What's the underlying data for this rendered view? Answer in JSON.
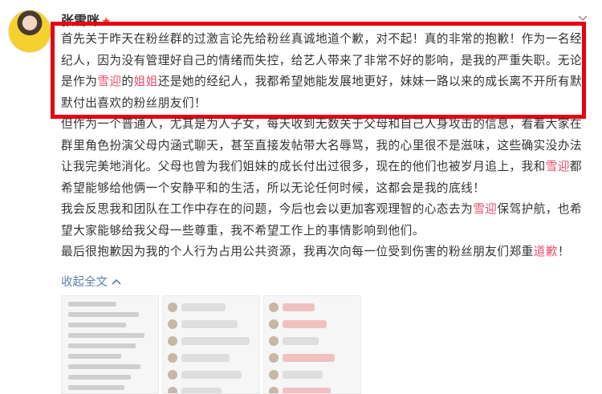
{
  "user": {
    "name": "张雪咪",
    "badge": "★"
  },
  "post": {
    "paragraph1": {
      "parts": [
        "首先关于昨天在粉丝群的过激言论先给粉丝真诚地道个歉，对不起！真的非常的抱歉！作为一名经纪人，因为没有管理好自己的情绪而失控，给艺人带来了非常不好的影响，是我的严重失职。无论是作为",
        "雪迎",
        "的",
        "姐姐",
        "还是她的经纪人，我都希望她能发展地更好，妹妹一路以来的成长离不开所有默默付出喜欢的粉丝朋友们！"
      ]
    },
    "paragraph2": {
      "parts": [
        "但作为一个普通人，尤其是为人子女，每天收到无数关于父母和自己人身攻击的信息，看着大家在群里角色扮演父母内涵式聊天，甚至直接发帖带大名辱骂，我的心里很不是滋味，这些确实没办法让我完美地消化。父母也曾为我们姐妹的成长付出过很多，现在的他们也被岁月追上，我和",
        "雪迎",
        "都希望能够给他俩一个安静平和的生活，所以无论任何时候，这都会是我的底线！"
      ]
    },
    "paragraph3": {
      "parts": [
        "我会反思我和团队在工作中存在的问题，今后也会以更加客观理智的心态去为",
        "雪迎",
        "保驾护航，也希望大家能够给我父母一些尊重，我不希望工作上的事情影响到他们。"
      ]
    },
    "paragraph4": {
      "parts": [
        "最后很抱歉因为我的个人行为占用公共资源，我再次向每一位受到伤害的粉丝朋友们郑重",
        "道歉",
        "！"
      ]
    },
    "collapse_label": "收起全文",
    "collapse_icon": "chevron-up"
  },
  "colors": {
    "highlight_border": "#e60012",
    "link": "#5e7fa8",
    "tag": "#d96470"
  }
}
